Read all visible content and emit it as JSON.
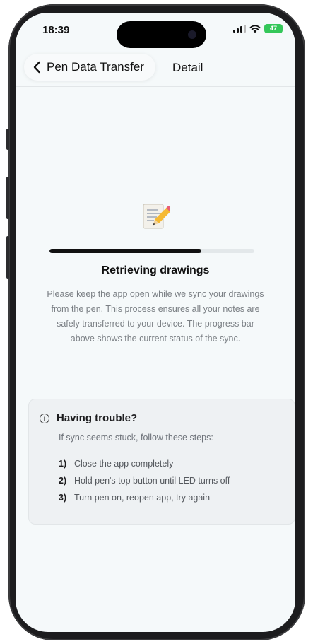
{
  "status_bar": {
    "time": "18:39",
    "battery": "47"
  },
  "nav": {
    "back_label": "Pen Data Transfer",
    "title": "Detail"
  },
  "sync": {
    "icon": "memo-pencil-emoji",
    "progress_fraction": 0.74,
    "title": "Retrieving drawings",
    "description": "Please keep the app open while we sync your drawings from the pen. This process ensures all your notes are safely transferred to your device. The progress bar above shows the current status of the sync."
  },
  "help": {
    "title": "Having trouble?",
    "intro": "If sync seems stuck, follow these steps:",
    "steps": [
      {
        "num": "1)",
        "text": "Close the app completely"
      },
      {
        "num": "2)",
        "text": "Hold pen's top button until LED turns off"
      },
      {
        "num": "3)",
        "text": "Turn pen on, reopen app, try again"
      }
    ]
  },
  "colors": {
    "screen_bg": "#f5f9fa",
    "progress_fill": "#111111",
    "progress_track": "#e3e8ea",
    "battery": "#34c759"
  }
}
